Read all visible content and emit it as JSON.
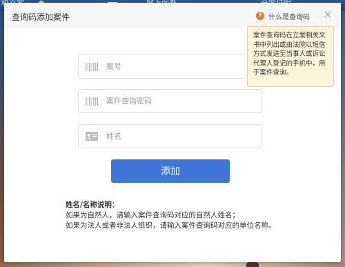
{
  "background": {
    "nav_items": [
      "校立案",
      "网上阅卷",
      "全效证明"
    ]
  },
  "dialog": {
    "title": "查询码添加案件",
    "help_label": "什么是查询码",
    "help_icon": "question-circle-icon",
    "close_icon": "close-icon",
    "tooltip": "案件查询码在立案相关文书中列出或由法院以短信方式发送至当事人或诉讼代理人登记的手机中，用于案件查询。"
  },
  "form": {
    "case_number": {
      "placeholder": "案号",
      "value": "",
      "icon": "barcode-icon"
    },
    "query_password": {
      "placeholder": "案件查询密码",
      "value": "",
      "icon": "barcode-icon"
    },
    "name": {
      "placeholder": "姓名",
      "value": "",
      "icon": "id-card-icon"
    },
    "submit_label": "添加"
  },
  "notes": {
    "title": "姓名/名称说明：",
    "line1": "如果为自然人，请输入案件查询码对应的自然人姓名；",
    "line2": "如果为法人或者非法人组织，请输入案件查询码对应的单位名称。"
  },
  "colors": {
    "primary_button": "#3f77d9",
    "help_icon": "#e8772e",
    "tooltip_bg": "#fdf5d9"
  }
}
